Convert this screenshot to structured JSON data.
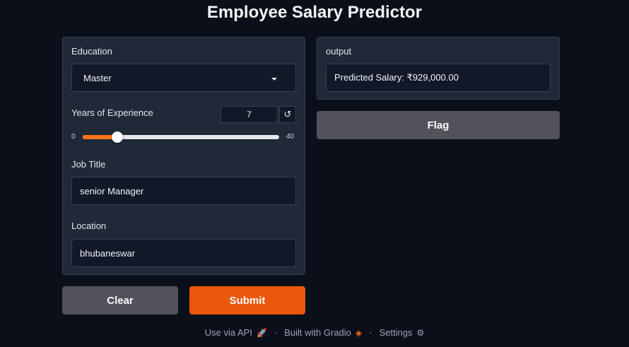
{
  "app": {
    "title": "Employee Salary Predictor"
  },
  "inputs": {
    "education": {
      "label": "Education",
      "value": "Master"
    },
    "experience": {
      "label": "Years of Experience",
      "value": 7,
      "min": 0,
      "max": 40,
      "reset_icon": "↺"
    },
    "job_title": {
      "label": "Job Title",
      "value": "senior Manager"
    },
    "location": {
      "label": "Location",
      "value": "bhubaneswar"
    }
  },
  "output": {
    "label": "output",
    "value": "Predicted Salary: ₹929,000.00"
  },
  "buttons": {
    "clear": "Clear",
    "submit": "Submit",
    "flag": "Flag"
  },
  "footer": {
    "api": "Use via API",
    "api_icon": "🚀",
    "built": "Built with Gradio",
    "built_icon": "◈",
    "settings": "Settings",
    "settings_icon": "⚙",
    "separator": "·"
  },
  "colors": {
    "accent": "#f97316",
    "primary_button": "#ea580c",
    "secondary_button": "#52525b",
    "background": "#0b0f19",
    "panel": "#1f2937"
  }
}
